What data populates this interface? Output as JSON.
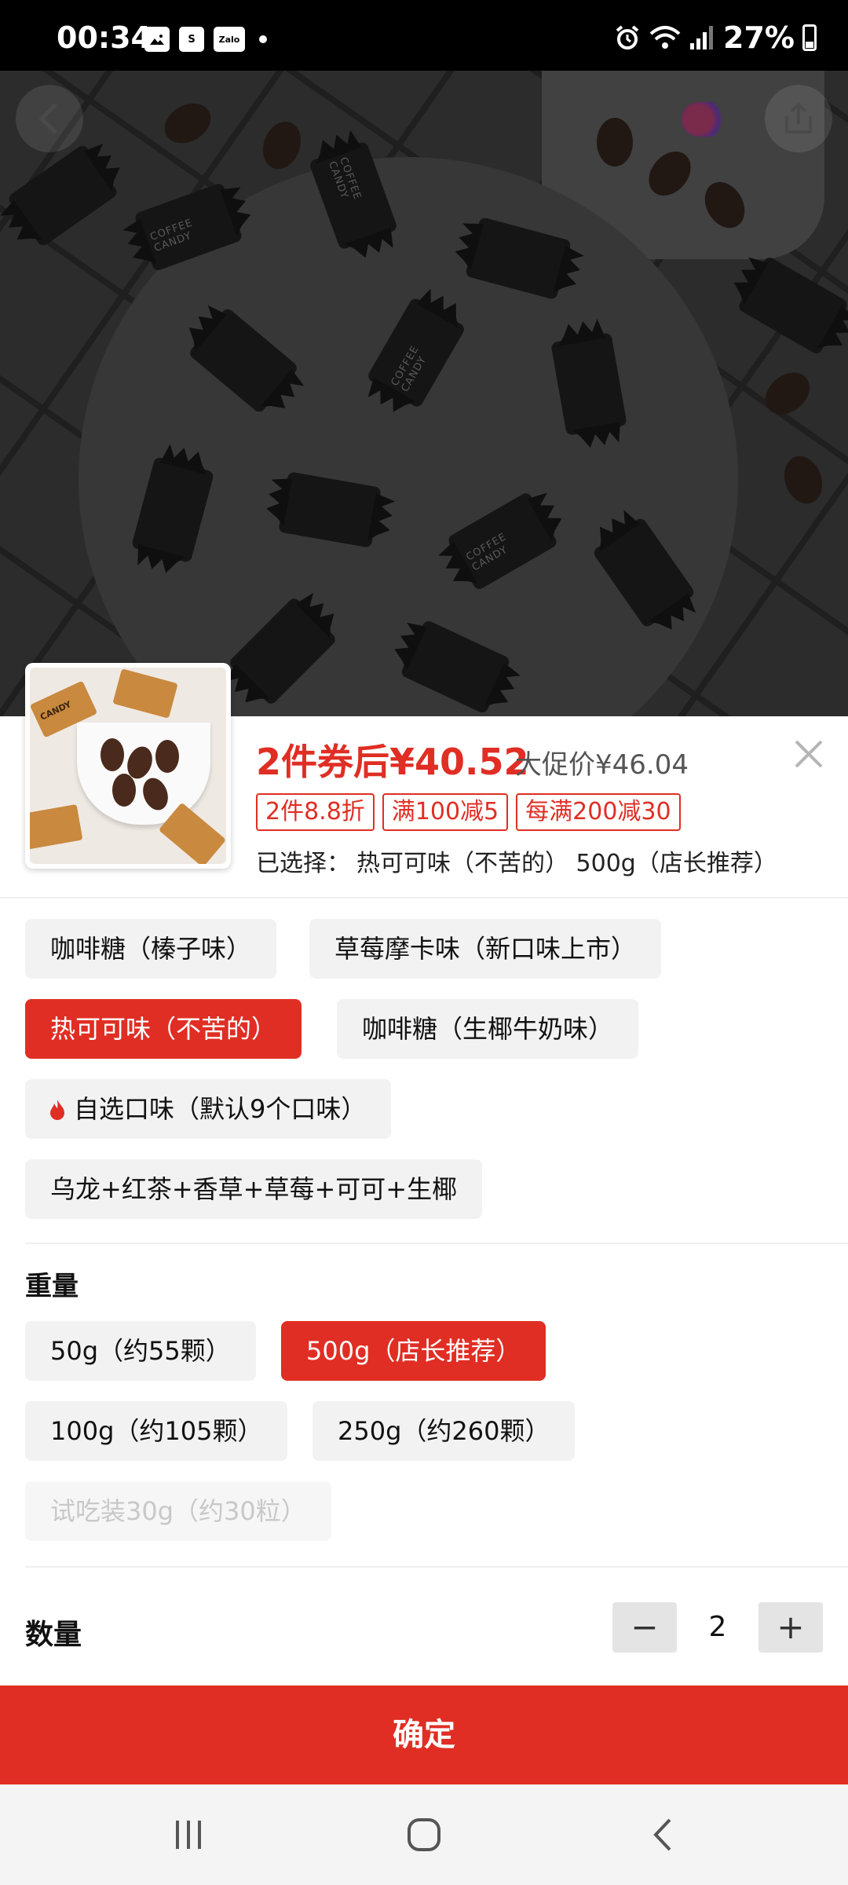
{
  "status_bar": {
    "time": "00:34",
    "notification_icons": [
      "gallery-icon",
      "shopee-icon",
      "zalo-icon"
    ],
    "zalo_label": "Zalo",
    "shopee_label": "S",
    "battery": "27%"
  },
  "photo": {
    "candy_wrapper_text": "COFFEE CANDY"
  },
  "thumbnail": {
    "wrapper_text": "CANDY"
  },
  "sheet": {
    "price": "2件券后¥40.52",
    "orig_price": "大促价¥46.04",
    "tags": [
      "2件8.8折",
      "满100减5",
      "每满200减30"
    ],
    "selected_label": "已选择：",
    "selected_value": "热可可味（不苦的） 500g（店长推荐）",
    "flavor_options": [
      "咖啡糖（榛子味）",
      "草莓摩卡味（新口味上市）",
      "热可可味（不苦的）",
      "咖啡糖（生椰牛奶味）",
      "自选口味（默认9个口味）",
      "乌龙+红茶+香草+草莓+可可+生椰"
    ],
    "weight_label": "重量",
    "weight_options": [
      "50g（约55颗）",
      "500g（店长推荐）",
      "100g（约105颗）",
      "250g（约260颗）",
      "试吃装30g（约30粒）"
    ],
    "quantity_label": "数量",
    "quantity": "2",
    "minus": "−",
    "plus": "+",
    "confirm": "确定"
  },
  "colors": {
    "accent": "#e02e24",
    "chip_bg": "#f2f2f2"
  }
}
